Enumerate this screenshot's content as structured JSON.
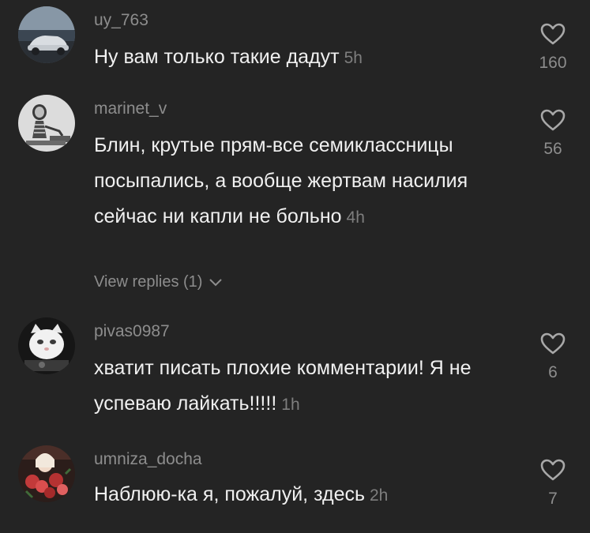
{
  "comments": [
    {
      "username": "uy_763",
      "text": "Ну вам только такие дадут",
      "time": "5h",
      "likes": "160",
      "avatar_icon": "car-photo-avatar"
    },
    {
      "username": "marinet_v",
      "text": "Блин, крутые прям-все семиклассницы посыпались, а вообще жертвам насилия сейчас ни капли не больно",
      "time": "4h",
      "likes": "56",
      "avatar_icon": "skeleton-photo-avatar",
      "replies_label": "View replies (1)"
    },
    {
      "username": "pivas0987",
      "text": "хватит писать плохие комментарии! Я не успеваю лайкать!!!!!",
      "time": "1h",
      "likes": "6",
      "avatar_icon": "cat-photo-avatar"
    },
    {
      "username": "umniza_docha",
      "text": "Наблюю-ка я, пожалуй, здесь",
      "time": "2h",
      "likes": "7",
      "avatar_icon": "flowers-photo-avatar"
    }
  ],
  "colors": {
    "background": "#242424",
    "text": "#f0f0f0",
    "muted": "#8d8d8d"
  },
  "icons": {
    "like": "heart-outline-icon",
    "expand": "chevron-down-icon"
  }
}
